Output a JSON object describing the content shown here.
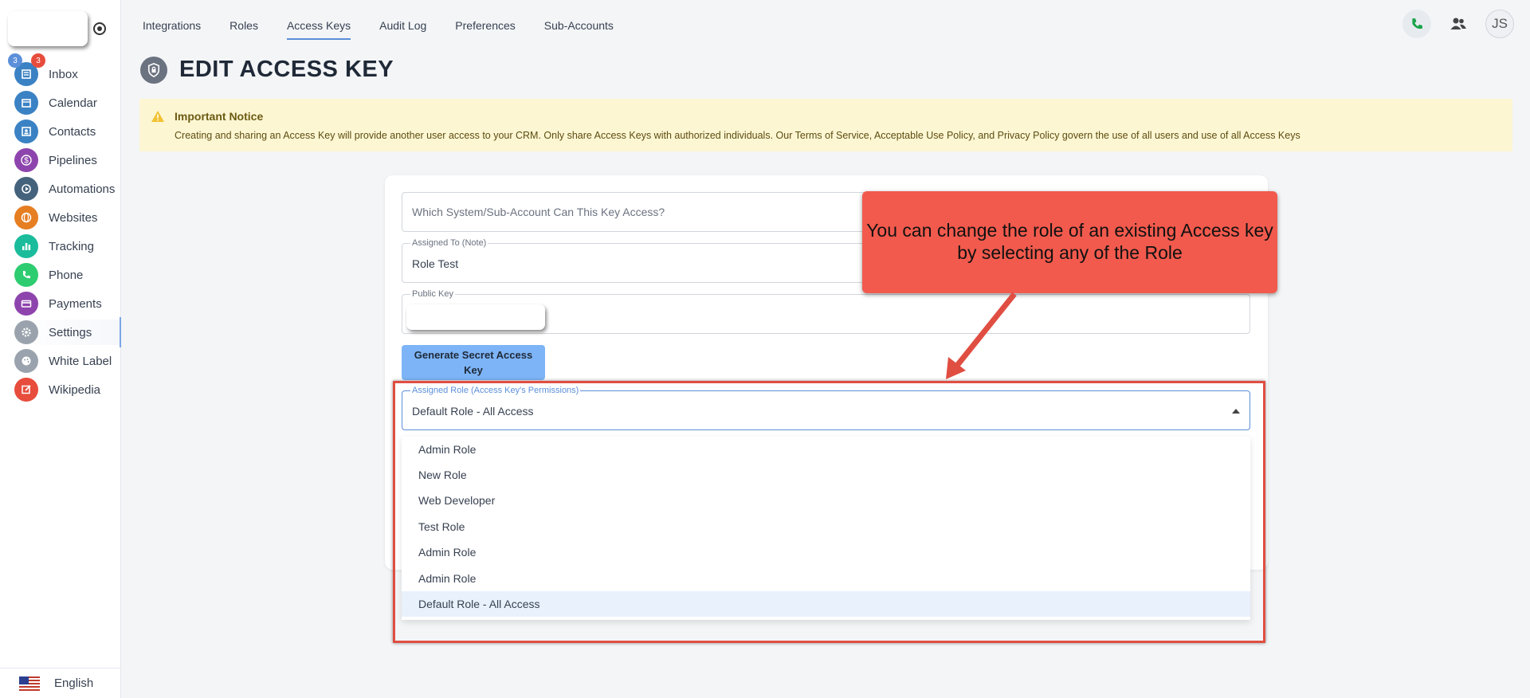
{
  "sidebar": {
    "items": [
      {
        "label": "Inbox",
        "icon": "inbox-icon",
        "color": "#3b82c4"
      },
      {
        "label": "Calendar",
        "icon": "calendar-icon",
        "color": "#3b82c4"
      },
      {
        "label": "Contacts",
        "icon": "contacts-icon",
        "color": "#3b82c4"
      },
      {
        "label": "Pipelines",
        "icon": "dollar-icon",
        "color": "#8e44ad"
      },
      {
        "label": "Automations",
        "icon": "automation-icon",
        "color": "#44627c"
      },
      {
        "label": "Websites",
        "icon": "websites-icon",
        "color": "#e67e22"
      },
      {
        "label": "Tracking",
        "icon": "tracking-icon",
        "color": "#1abc9c"
      },
      {
        "label": "Phone",
        "icon": "phone-icon",
        "color": "#2ecc71"
      },
      {
        "label": "Payments",
        "icon": "payments-icon",
        "color": "#8e44ad"
      },
      {
        "label": "Settings",
        "icon": "gear-icon",
        "color": "#9aa3ad"
      },
      {
        "label": "White Label",
        "icon": "palette-icon",
        "color": "#9aa3ad"
      },
      {
        "label": "Wikipedia",
        "icon": "edit-icon",
        "color": "#e74c3c"
      }
    ],
    "inbox_badges": [
      "3",
      "3"
    ],
    "language": "English"
  },
  "tabs": [
    "Integrations",
    "Roles",
    "Access Keys",
    "Audit Log",
    "Preferences",
    "Sub-Accounts"
  ],
  "header": {
    "avatar_initials": "JS"
  },
  "page": {
    "title": "EDIT ACCESS KEY"
  },
  "notice": {
    "title": "Important Notice",
    "text": "Creating and sharing an Access Key will provide another user access to your CRM. Only share Access Keys with authorized individuals. Our Terms of Service, Acceptable Use Policy, and Privacy Policy govern the use of all users and use of all Access Keys"
  },
  "form": {
    "system_placeholder": "Which System/Sub-Account Can This Key Access?",
    "assigned_to_label": "Assigned To (Note)",
    "assigned_to_value": "Role Test",
    "public_key_label": "Public Key",
    "generate_button": "Generate Secret Access Key",
    "role_label": "Assigned Role (Access Key's Permissions)",
    "role_value": "Default Role - All Access",
    "role_options": [
      "Admin Role",
      "New Role",
      "Web Developer",
      "Test Role",
      "Admin Role",
      "Admin Role",
      "Default Role - All Access"
    ]
  },
  "callout": {
    "text": "You can change the role of an existing Access key by selecting any of the Role"
  },
  "colors": {
    "accent": "#5b8fd9",
    "callout": "#f25a4d",
    "notice_bg": "#fdf6d3"
  }
}
